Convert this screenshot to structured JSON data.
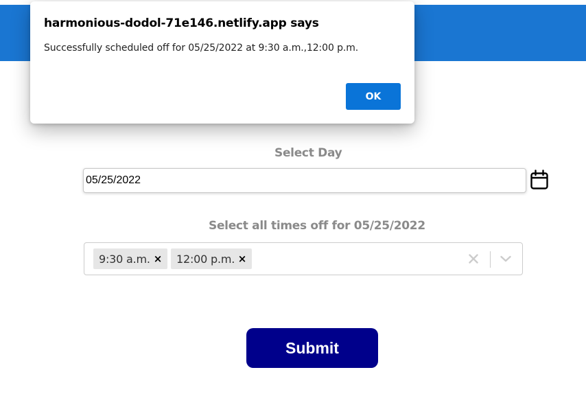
{
  "alert": {
    "title": "harmonious-dodol-71e146.netlify.app says",
    "message": "Successfully scheduled off for 05/25/2022 at 9:30 a.m.,12:00 p.m.",
    "ok_label": "OK"
  },
  "form": {
    "day_label": "Select Day",
    "date_value": "05/25/2022",
    "times_label": "Select all times off for 05/25/2022",
    "selected_times": [
      {
        "label": "9:30 a.m.",
        "remove": "×"
      },
      {
        "label": "12:00 p.m.",
        "remove": "×"
      }
    ],
    "submit_label": "Submit"
  },
  "icons": {
    "calendar": "calendar-icon",
    "clear": "clear-icon",
    "dropdown": "chevron-down-icon",
    "remove": "close-icon"
  },
  "colors": {
    "header": "#1a76d2",
    "ok_button": "#0a74d8",
    "submit_button": "#00008b",
    "label": "#8a8a8a",
    "chip_background": "#e6e6e6"
  }
}
